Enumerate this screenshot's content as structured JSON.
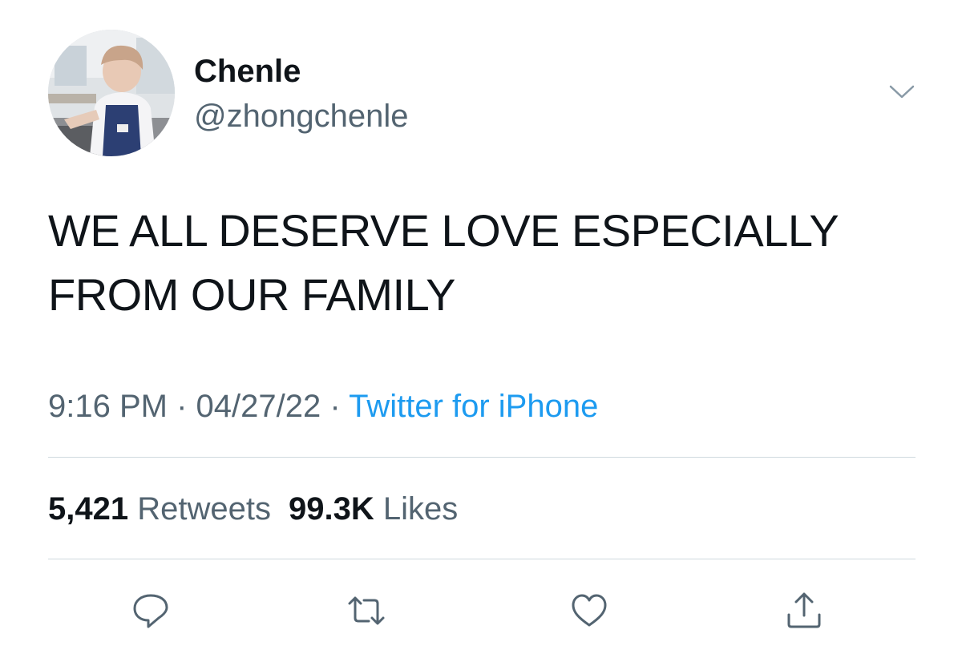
{
  "author": {
    "display_name": "Chenle",
    "handle": "@zhongchenle",
    "avatar": "profile-photo"
  },
  "tweet": {
    "text_line1": "WE ALL DESERVE LOVE ESPECIALLY",
    "text_line2": "FROM OUR FAMILY",
    "time": "9:16 PM",
    "separator": "·",
    "date": "04/27/22",
    "source": "Twitter for iPhone"
  },
  "stats": {
    "retweets_count": "5,421",
    "retweets_label": "Retweets",
    "likes_count": "99.3K",
    "likes_label": "Likes"
  },
  "actions": {
    "icons": [
      "reply-icon",
      "retweet-icon",
      "like-icon",
      "share-icon"
    ]
  },
  "colors": {
    "text": "#0f1419",
    "secondary": "#536471",
    "link": "#1d9bf0",
    "divider": "#cfd9de"
  }
}
